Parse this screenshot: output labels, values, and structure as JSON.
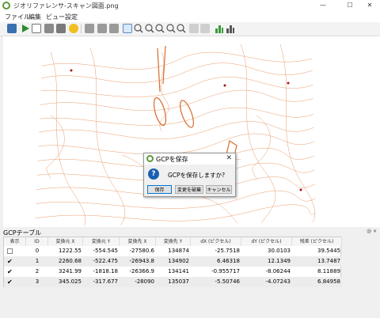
{
  "window": {
    "title": "ジオリファレンサ-スキャン図面.png",
    "minimize": "—",
    "maximize": "☐",
    "close": "✕"
  },
  "menu": [
    "ファイル",
    "編集",
    "ビュー",
    "設定"
  ],
  "toolbar": {
    "icons": [
      "open-raster-icon",
      "start-georeferencing-icon",
      "generate-gdal-script-icon",
      "load-gcp-icon",
      "save-gcp-icon",
      "settings-icon",
      "add-point-icon",
      "delete-point-icon",
      "move-point-icon",
      "pan-icon",
      "zoom-in-icon",
      "zoom-out-icon",
      "zoom-to-layer-icon",
      "zoom-last-icon",
      "zoom-next-icon",
      "link-georef-to-qgis-icon",
      "link-qgis-to-georef-icon",
      "histogram-icon",
      "full-histogram-icon"
    ]
  },
  "dialog": {
    "title": "GCPを保存",
    "close": "✕",
    "icon": "?",
    "message": "GCPを保存しますか?",
    "buttons": [
      "保存",
      "変更を破棄",
      "キャンセル"
    ]
  },
  "gcp_panel": {
    "title": "GCPテーブル",
    "controls": "@ ✕",
    "columns": [
      "表示",
      "ID",
      "変換元 X",
      "変換元 Y",
      "変換先 X",
      "変換先 Y",
      "dX (ピクセル)",
      "dY (ピクセル)",
      "残差 (ピクセル)"
    ],
    "rows": [
      {
        "visible": false,
        "id": "0",
        "src_x": "1222.55",
        "src_y": "-554.545",
        "dst_x": "-27580.6",
        "dst_y": "134874",
        "dx": "-25.7518",
        "dy": "30.0103",
        "residual": "39.5445"
      },
      {
        "visible": true,
        "id": "1",
        "src_x": "2260.68",
        "src_y": "-522.475",
        "dst_x": "-26943.8",
        "dst_y": "134902",
        "dx": "6.46318",
        "dy": "12.1349",
        "residual": "13.7487"
      },
      {
        "visible": true,
        "id": "2",
        "src_x": "3241.99",
        "src_y": "-1818.18",
        "dst_x": "-26366.9",
        "dst_y": "134141",
        "dx": "-0.955717",
        "dy": "-8.06244",
        "residual": "8.11889"
      },
      {
        "visible": true,
        "id": "3",
        "src_x": "345.025",
        "src_y": "-317.677",
        "dst_x": "-28090",
        "dst_y": "135037",
        "dx": "-5.50746",
        "dy": "-4.07243",
        "residual": "6.84958"
      }
    ]
  },
  "colors": {
    "contour": "#e07a3a",
    "gcp_point": "#b01010",
    "accent": "#0078d7",
    "qgis_green": "#5a9a3a"
  }
}
